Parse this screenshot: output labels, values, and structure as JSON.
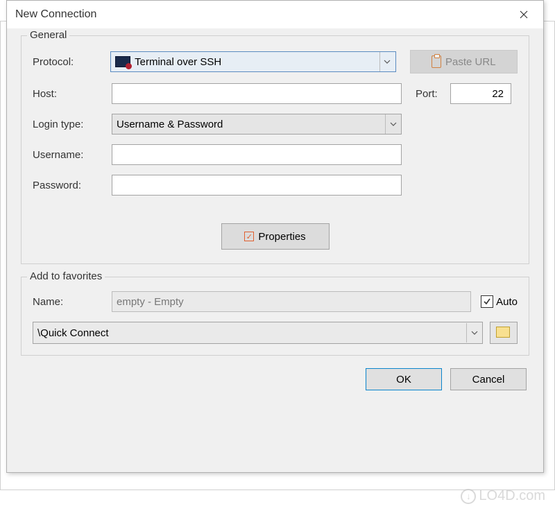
{
  "dialog": {
    "title": "New Connection",
    "general": {
      "group_title": "General",
      "protocol_label": "Protocol:",
      "protocol_value": "Terminal over SSH",
      "paste_url_label": "Paste URL",
      "host_label": "Host:",
      "host_value": "",
      "port_label": "Port:",
      "port_value": "22",
      "login_type_label": "Login type:",
      "login_type_value": "Username & Password",
      "username_label": "Username:",
      "username_value": "",
      "password_label": "Password:",
      "password_value": "",
      "properties_label": "Properties"
    },
    "favorites": {
      "group_title": "Add to favorites",
      "name_label": "Name:",
      "name_value": "empty - Empty",
      "auto_label": "Auto",
      "auto_checked": true,
      "path_value": "\\Quick Connect"
    },
    "buttons": {
      "ok": "OK",
      "cancel": "Cancel"
    }
  },
  "watermark": "LO4D.com"
}
